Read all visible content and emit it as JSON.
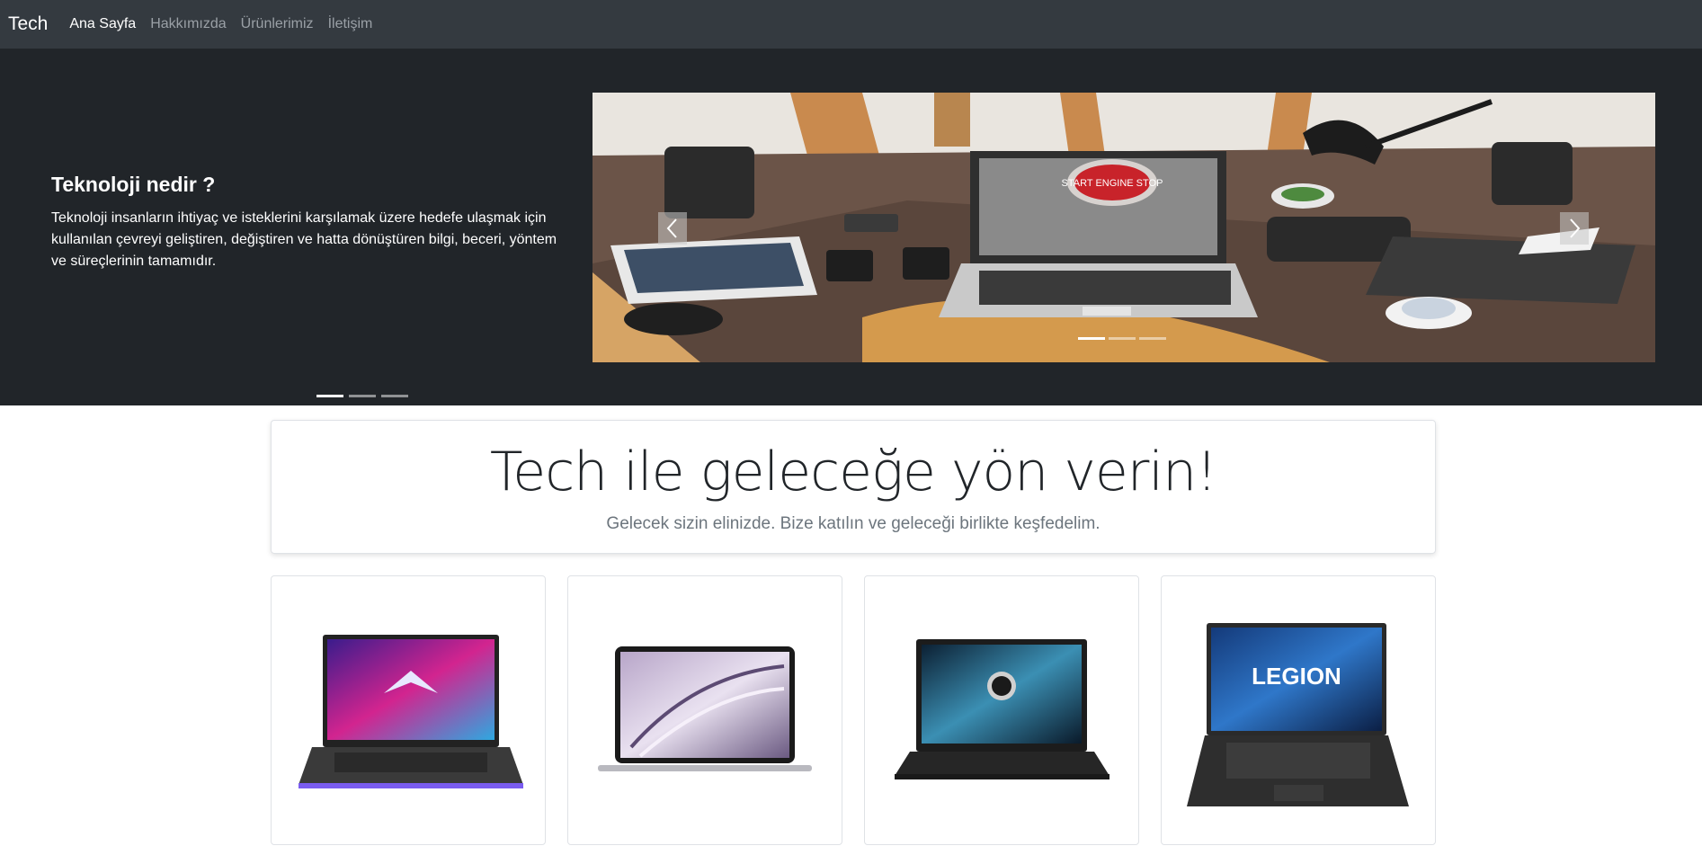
{
  "navbar": {
    "brand": "Tech",
    "links": [
      "Ana Sayfa",
      "Hakkımızda",
      "Ürünlerimiz",
      "İletişim"
    ]
  },
  "hero": {
    "title": "Teknoloji nedir ?",
    "body": "Teknoloji insanların ihtiyaç ve isteklerini karşılamak üzere hedefe ulaşmak için kullanılan çevreyi geliştiren, değiştiren ve hatta dönüştüren bilgi, beceri, yöntem ve süreçlerinin tamamıdır.",
    "image_text": "START ENGINE STOP",
    "controls": {
      "prev_icon": "chevron-left-icon",
      "next_icon": "chevron-right-icon"
    }
  },
  "jumbotron": {
    "title": "Tech ile geleceğe yön verin!",
    "subtitle": "Gelecek sizin elinizde. Bize katılın ve geleceği birlikte keşfedelim."
  },
  "products": {
    "legion_logo_text": "LEGION"
  },
  "colors": {
    "navbar_bg": "#343a40",
    "hero_bg": "#212529",
    "page_bg": "#ffffff"
  }
}
